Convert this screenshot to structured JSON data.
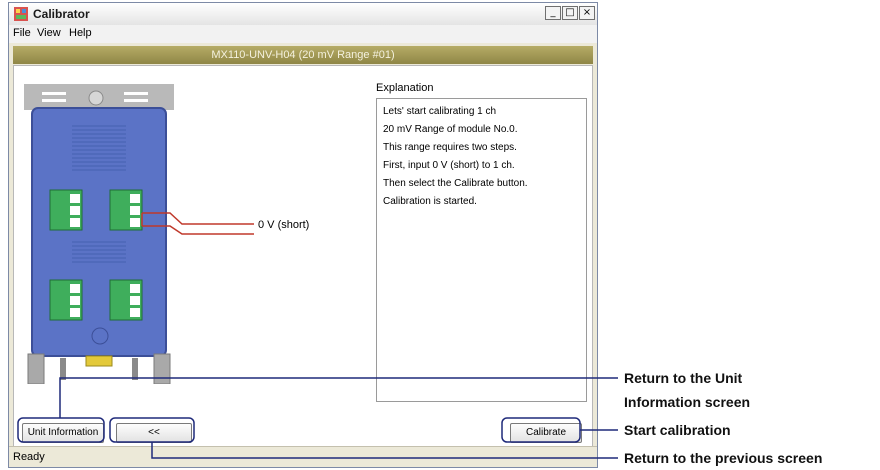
{
  "window": {
    "title": "Calibrator",
    "minimize_glyph": "_",
    "maximize_glyph": "□",
    "close_glyph": "×"
  },
  "menu": {
    "items": [
      "File",
      "View",
      "Help"
    ]
  },
  "header": {
    "text": "MX110-UNV-H04 (20 mV Range #01)"
  },
  "wire_label": "0 V (short)",
  "explanation": {
    "label": "Explanation",
    "lines": [
      "Lets' start calibrating 1 ch",
      "20 mV Range of module No.0.",
      "This range requires two steps.",
      "First, input 0 V (short) to 1 ch.",
      "Then select the Calibrate button.",
      "Calibration is started."
    ]
  },
  "buttons": {
    "unit_information": "Unit Information",
    "back": "<<",
    "calibrate": "Calibrate"
  },
  "status": "Ready",
  "callouts": {
    "unit_info_line1": "Return to the Unit",
    "unit_info_line2": "Information screen",
    "calibrate": "Start calibration",
    "back": "Return to the previous screen"
  },
  "colors": {
    "header_band": "#a39a58",
    "module_body": "#5b73c6",
    "terminal": "#3fae5c",
    "callout_line": "#1f2a7a",
    "wire": "#c0392b"
  }
}
